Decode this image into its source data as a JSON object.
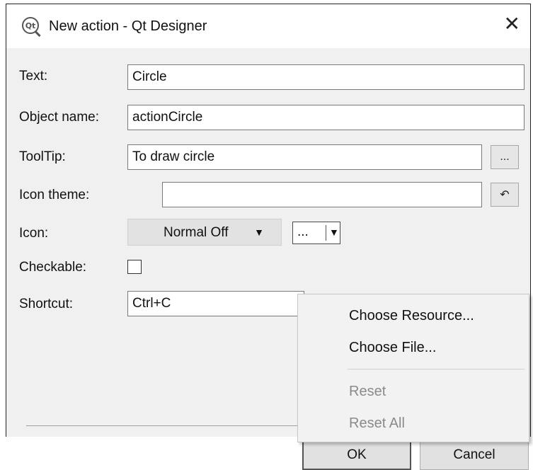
{
  "window": {
    "title": "New action - Qt Designer",
    "icon": "qt-icon",
    "icon_text": "Qt",
    "close_symbol": "✕"
  },
  "form": {
    "text_label": "Text:",
    "text_value": "Circle",
    "object_name_label": "Object name:",
    "object_name_value": "actionCircle",
    "tooltip_label": "ToolTip:",
    "tooltip_value": "To draw circle",
    "tooltip_button": "...",
    "icon_theme_label": "Icon theme:",
    "icon_theme_value": "",
    "icon_theme_button_icon": "undo-arrow-icon",
    "icon_label": "Icon:",
    "icon_mode": "Normal Off",
    "icon_tool_button": "...",
    "checkable_label": "Checkable:",
    "checkable_checked": false,
    "shortcut_label": "Shortcut:",
    "shortcut_value": "Ctrl+C"
  },
  "menu": {
    "items": [
      {
        "label": "Choose Resource...",
        "enabled": true
      },
      {
        "label": "Choose File...",
        "enabled": true
      },
      {
        "label": "Reset",
        "enabled": false
      },
      {
        "label": "Reset All",
        "enabled": false
      }
    ]
  },
  "buttons": {
    "ok": "OK",
    "cancel": "Cancel"
  }
}
